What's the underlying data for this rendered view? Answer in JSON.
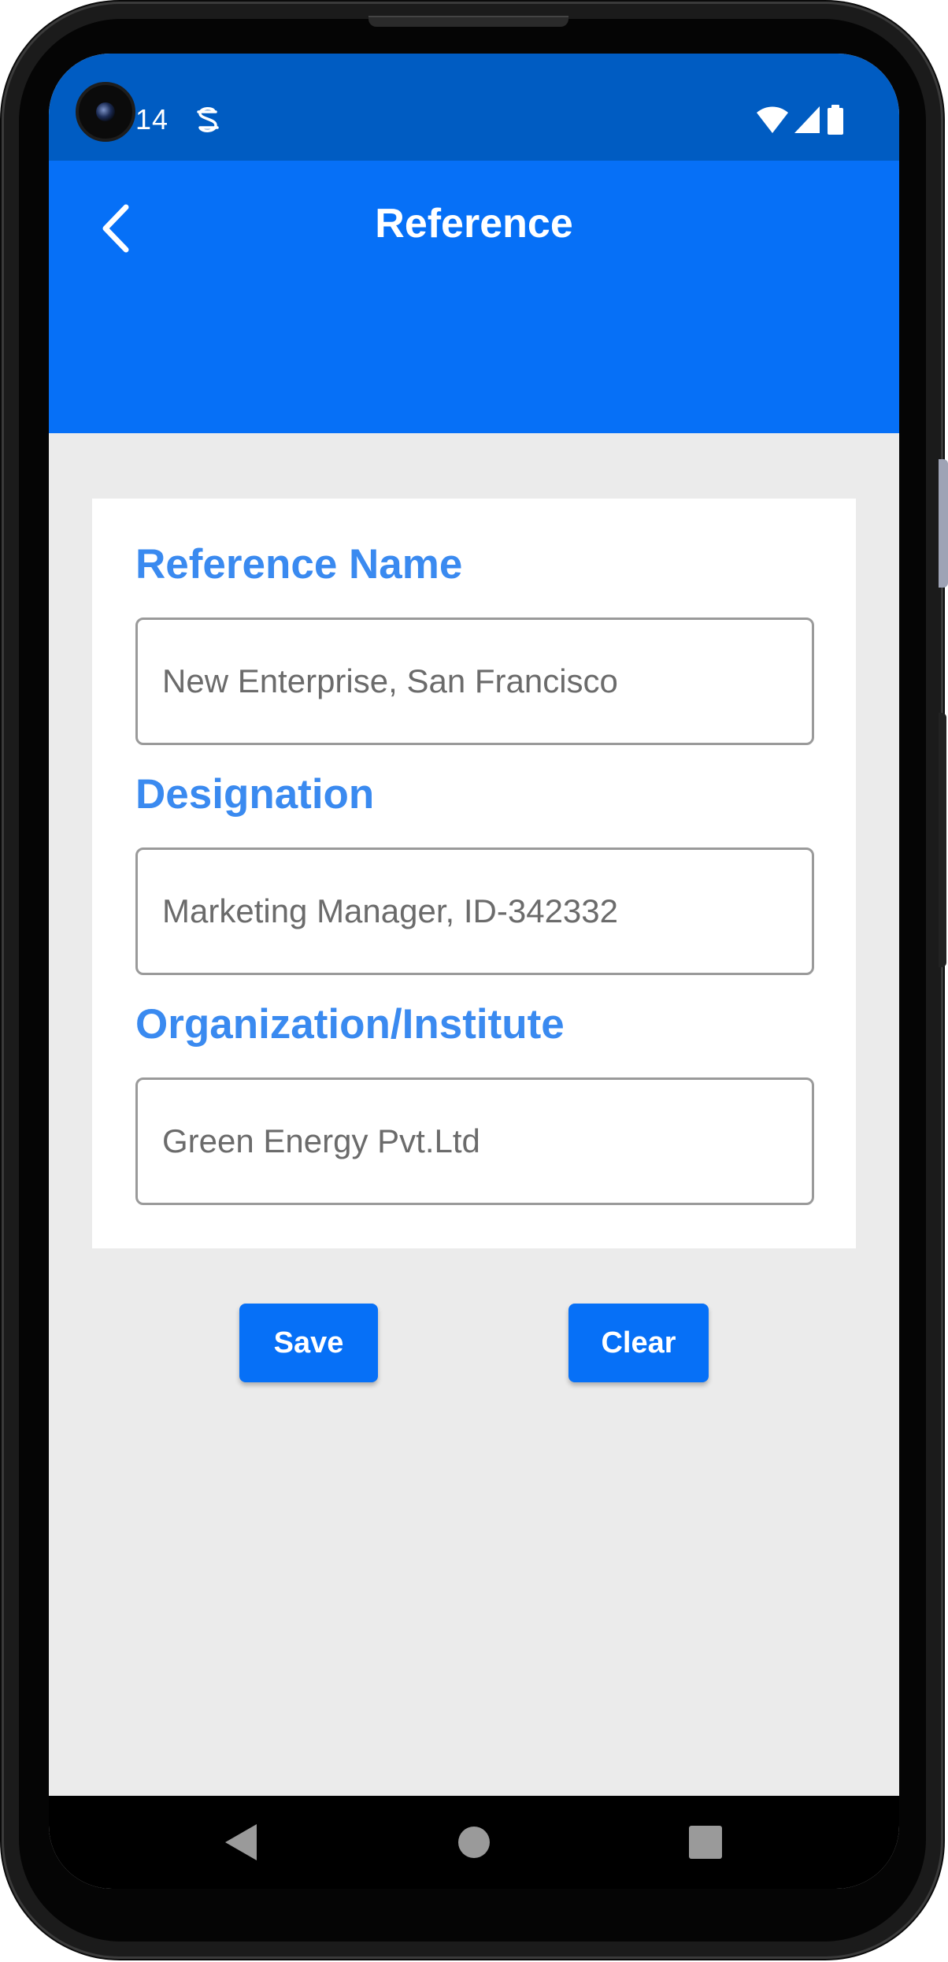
{
  "status_bar": {
    "time": "14",
    "notification_icon": "s-notification-icon",
    "right_icons": [
      "wifi-icon",
      "cell-signal-icon",
      "battery-icon"
    ]
  },
  "app_bar": {
    "title": "Reference",
    "back_icon": "chevron-left-icon"
  },
  "form": {
    "fields": [
      {
        "label": "Reference Name",
        "value": "New Enterprise, San Francisco"
      },
      {
        "label": "Designation",
        "value": "Marketing Manager, ID-342332"
      },
      {
        "label": "Organization/Institute",
        "value": "Green Energy Pvt.Ltd"
      }
    ]
  },
  "actions": {
    "save_label": "Save",
    "clear_label": "Clear"
  },
  "nav_bar": {
    "buttons": [
      "back-triangle-icon",
      "home-circle-icon",
      "recents-square-icon"
    ]
  },
  "colors": {
    "status_bar": "#005cc2",
    "app_bar": "#0670f7",
    "label": "#3a8af0",
    "button": "#0670f7",
    "background": "#ebebeb"
  }
}
